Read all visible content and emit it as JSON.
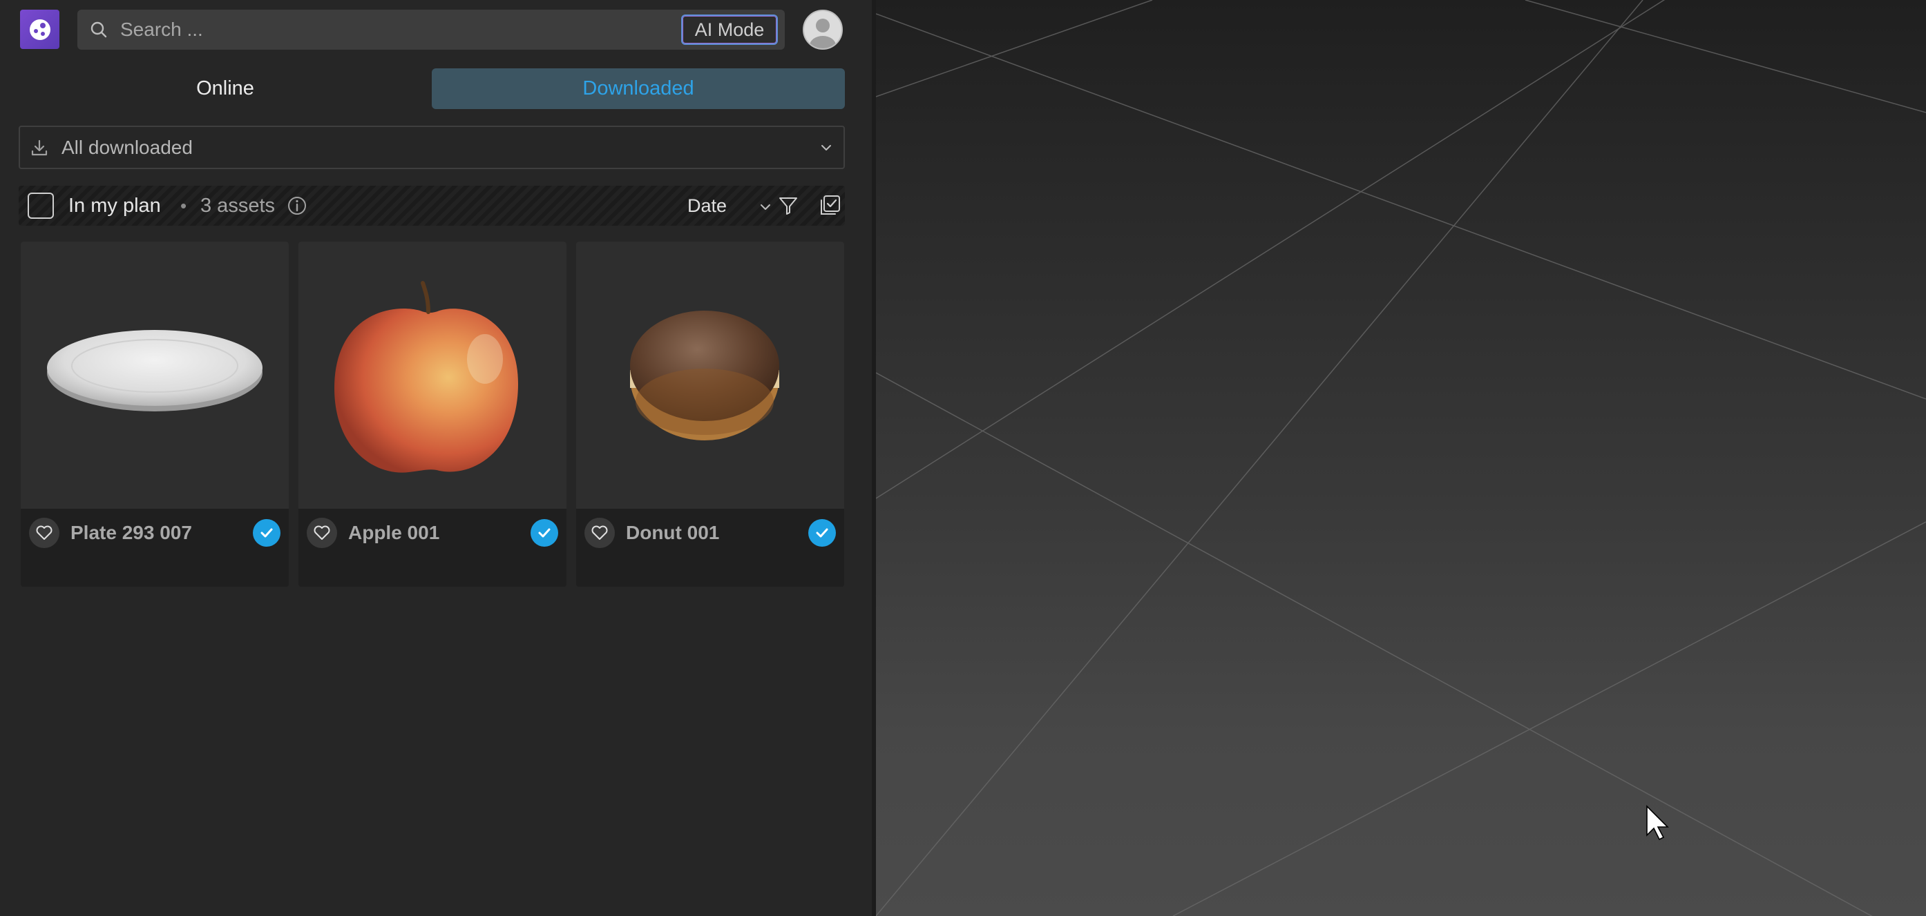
{
  "header": {
    "search_placeholder": "Search ...",
    "ai_mode_label": "AI Mode"
  },
  "tabs": [
    {
      "label": "Online",
      "active": false
    },
    {
      "label": "Downloaded",
      "active": true
    }
  ],
  "dropdown": {
    "selected": "All downloaded"
  },
  "filterbar": {
    "plan_label": "In my plan",
    "separator": "•",
    "asset_count": "3 assets",
    "sort_label": "Date"
  },
  "assets": [
    {
      "name": "Plate 293 007",
      "favorited": false,
      "downloaded": true
    },
    {
      "name": "Apple 001",
      "favorited": false,
      "downloaded": true
    },
    {
      "name": "Donut 001",
      "favorited": false,
      "downloaded": true
    }
  ],
  "colors": {
    "accent": "#2ea3e8",
    "active_tab_bg": "#3c5562",
    "check_badge": "#1ea1e3",
    "logo": "#6a43c4"
  }
}
